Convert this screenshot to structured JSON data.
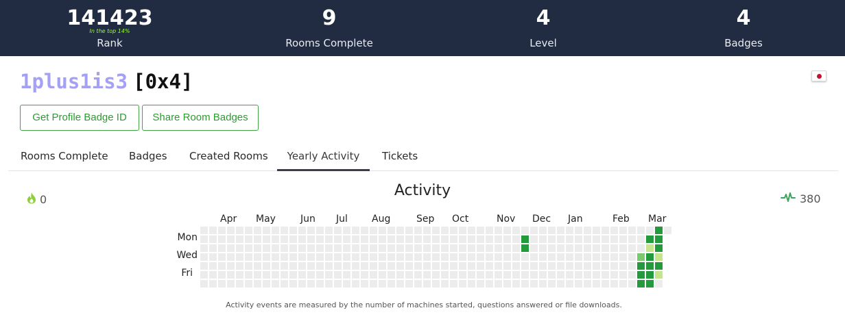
{
  "stats": {
    "rank": {
      "value": "141423",
      "sub": "In the top 14%",
      "label": "Rank"
    },
    "rooms": {
      "value": "9",
      "label": "Rooms Complete"
    },
    "level": {
      "value": "4",
      "label": "Level"
    },
    "badges": {
      "value": "4",
      "label": "Badges"
    }
  },
  "profile": {
    "username": "1plus1is3",
    "level_tag": "[0x4]",
    "flag": "japan-flag-icon"
  },
  "buttons": {
    "badge_id": "Get Profile Badge ID",
    "share": "Share Room Badges"
  },
  "tabs": [
    {
      "label": "Rooms Complete",
      "active": false
    },
    {
      "label": "Badges",
      "active": false
    },
    {
      "label": "Created Rooms",
      "active": false
    },
    {
      "label": "Yearly Activity",
      "active": true
    },
    {
      "label": "Tickets",
      "active": false
    }
  ],
  "activity": {
    "title": "Activity",
    "streak": "0",
    "streak_icon": "flame-icon",
    "events": "380",
    "events_icon": "pulse-icon",
    "months": [
      "Apr",
      "May",
      "Jun",
      "Jul",
      "Aug",
      "Sep",
      "Oct",
      "Nov",
      "Dec",
      "Jan",
      "Feb",
      "Mar"
    ],
    "day_labels": [
      "Mon",
      "Wed",
      "Fri"
    ],
    "footnote": "Activity events are measured by the number of machines started, questions answered or file downloads.",
    "colors": {
      "empty": "#ececec",
      "light": "#c6e48b",
      "mid": "#7bc96f",
      "dark": "#239a3b"
    },
    "active_cells": [
      {
        "week": 36,
        "day": 1,
        "level": "dark"
      },
      {
        "week": 36,
        "day": 2,
        "level": "dark"
      },
      {
        "week": 50,
        "day": 1,
        "level": "dark"
      },
      {
        "week": 50,
        "day": 2,
        "level": "light"
      },
      {
        "week": 50,
        "day": 3,
        "level": "dark"
      },
      {
        "week": 50,
        "day": 4,
        "level": "dark"
      },
      {
        "week": 50,
        "day": 5,
        "level": "dark"
      },
      {
        "week": 50,
        "day": 6,
        "level": "dark"
      },
      {
        "week": 51,
        "day": 0,
        "level": "dark"
      },
      {
        "week": 51,
        "day": 1,
        "level": "dark"
      },
      {
        "week": 51,
        "day": 2,
        "level": "dark"
      },
      {
        "week": 51,
        "day": 3,
        "level": "light"
      },
      {
        "week": 51,
        "day": 4,
        "level": "dark"
      },
      {
        "week": 51,
        "day": 5,
        "level": "light"
      },
      {
        "week": 49,
        "day": 3,
        "level": "mid"
      },
      {
        "week": 49,
        "day": 4,
        "level": "dark"
      },
      {
        "week": 49,
        "day": 5,
        "level": "dark"
      },
      {
        "week": 49,
        "day": 6,
        "level": "dark"
      }
    ]
  }
}
